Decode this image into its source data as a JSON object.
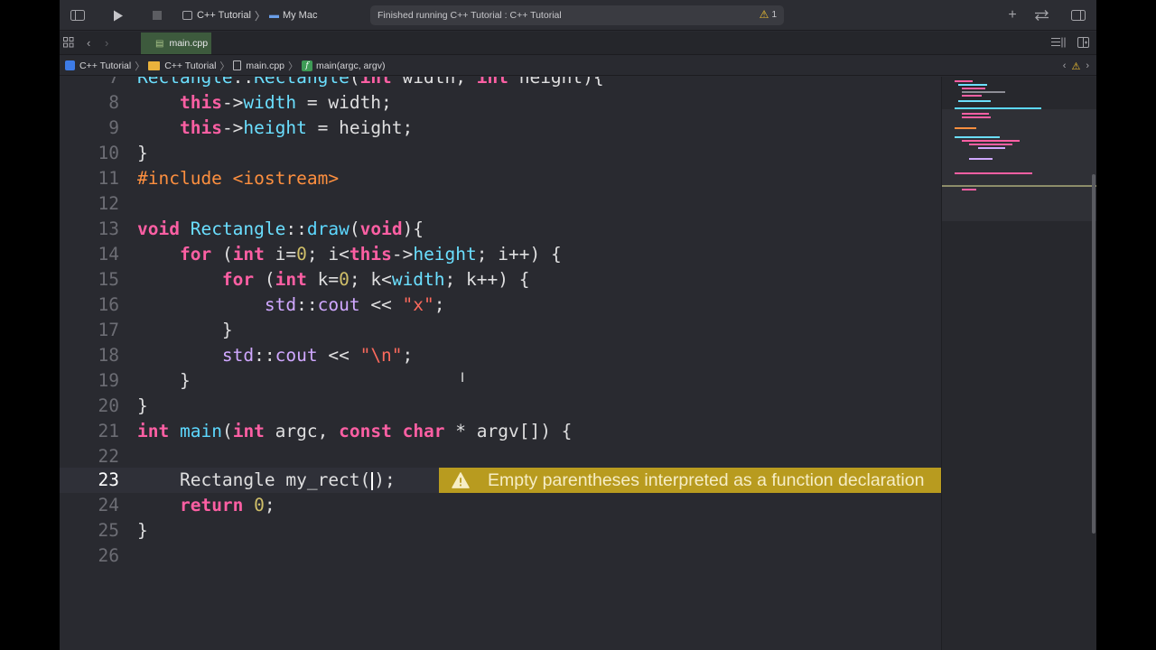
{
  "toolbar": {
    "scheme": "C++ Tutorial",
    "destination": "My Mac",
    "status": "Finished running C++ Tutorial : C++ Tutorial",
    "warning_count": "1"
  },
  "tab": {
    "label": "main.cpp"
  },
  "jumpbar": {
    "items": [
      "C++ Tutorial",
      "C++ Tutorial",
      "main.cpp",
      "main(argc, argv)"
    ],
    "function_glyph": "f"
  },
  "editor": {
    "line_numbers": [
      "7",
      "8",
      "9",
      "10",
      "11",
      "12",
      "13",
      "14",
      "15",
      "16",
      "17",
      "18",
      "19",
      "20",
      "21",
      "22",
      "23",
      "24",
      "25",
      "26"
    ],
    "current_line": "23"
  },
  "warning": {
    "message": "Empty parentheses interpreted as a function declaration"
  },
  "colors": {
    "keyword": "#fc5fa3",
    "type": "#6bdfff",
    "preprocessor": "#fd8f3f",
    "string": "#fc6a5d",
    "number": "#d0bf69",
    "warning_bg": "#b89b1f"
  }
}
